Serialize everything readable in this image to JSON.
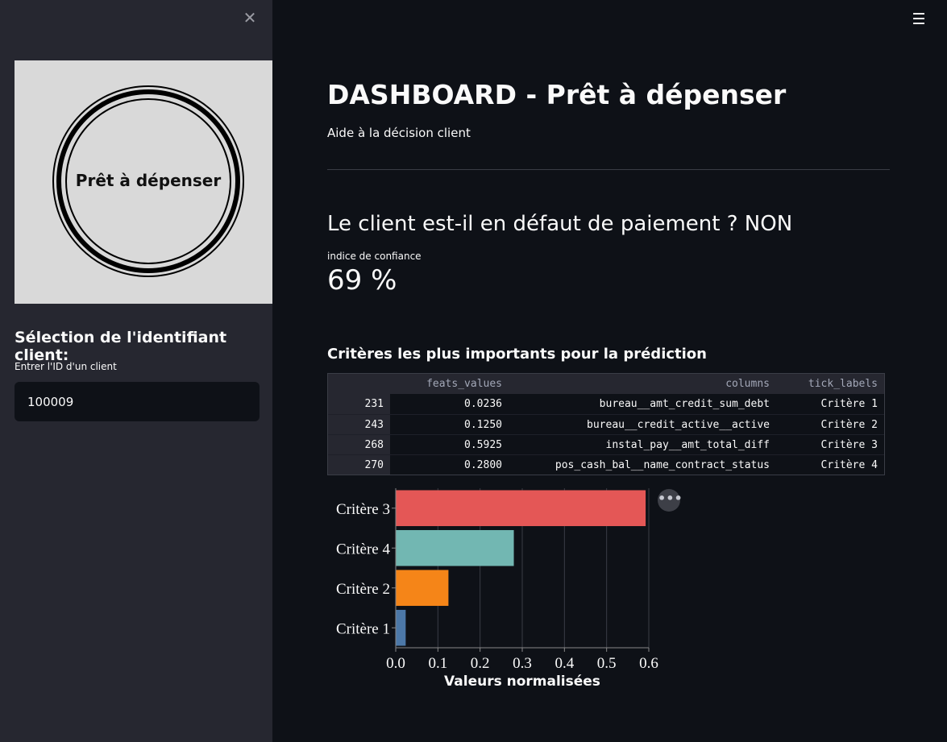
{
  "sidebar": {
    "close_icon": "close-icon",
    "logo_text": "Prêt à dépenser",
    "heading": "Sélection de l'identifiant client:",
    "input_label": "Entrer l'ID d'un client",
    "input_value": "100009"
  },
  "header": {
    "menu_icon": "hamburger-menu-icon"
  },
  "main": {
    "title": "DASHBOARD - Prêt à dépenser",
    "subtitle": "Aide à la décision client",
    "question": "Le client est-il en défaut de paiement ? NON",
    "metric_label": "indice de confiance",
    "metric_value": "69 %",
    "section_title": "Critères les plus importants pour la prédiction"
  },
  "table": {
    "headers": [
      "",
      "feats_values",
      "columns",
      "tick_labels"
    ],
    "rows": [
      {
        "idx": "231",
        "feats_values": "0.0236",
        "columns": "bureau__amt_credit_sum_debt",
        "tick_labels": "Critère 1"
      },
      {
        "idx": "243",
        "feats_values": "0.1250",
        "columns": "bureau__credit_active__active",
        "tick_labels": "Critère 2"
      },
      {
        "idx": "268",
        "feats_values": "0.5925",
        "columns": "instal_pay__amt_total_diff",
        "tick_labels": "Critère 3"
      },
      {
        "idx": "270",
        "feats_values": "0.2800",
        "columns": "pos_cash_bal__name_contract_status",
        "tick_labels": "Critère 4"
      }
    ]
  },
  "chart_data": {
    "type": "bar",
    "orientation": "horizontal",
    "categories": [
      "Critère 3",
      "Critère 4",
      "Critère 2",
      "Critère 1"
    ],
    "values": [
      0.5925,
      0.28,
      0.125,
      0.0236
    ],
    "colors": [
      "#e45756",
      "#72b7b2",
      "#f58518",
      "#4c78a8"
    ],
    "xlabel": "Valeurs normalisées",
    "ylabel": "",
    "xlim": [
      0,
      0.6
    ],
    "xticks": [
      "0.0",
      "0.1",
      "0.2",
      "0.3",
      "0.4",
      "0.5",
      "0.6"
    ],
    "grid": true
  },
  "colors": {
    "background": "#0e1117",
    "sidebar": "#262730",
    "text": "#fafafa"
  }
}
